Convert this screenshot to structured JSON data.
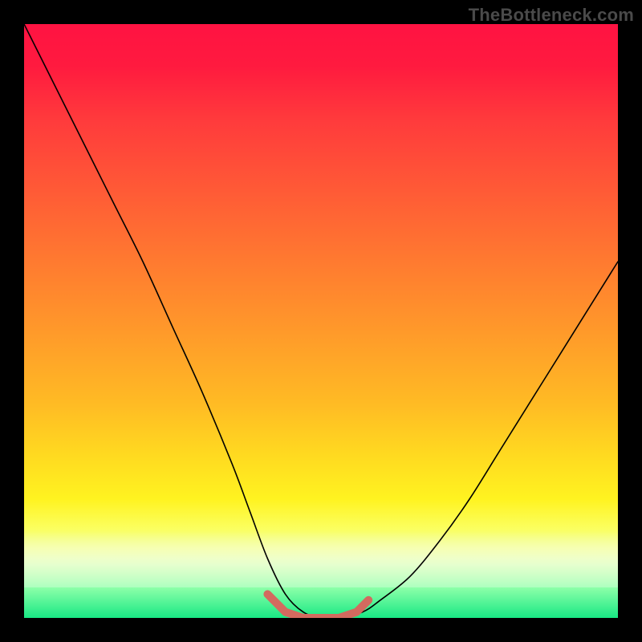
{
  "watermark": "TheBottleneck.com",
  "colors": {
    "background": "#000000",
    "curve": "#000000",
    "valley_highlight": "#d36a5f",
    "gradient_top": "#ff1342",
    "gradient_bottom": "#18e884"
  },
  "chart_data": {
    "type": "line",
    "title": "",
    "xlabel": "",
    "ylabel": "",
    "xlim": [
      0,
      100
    ],
    "ylim": [
      0,
      100
    ],
    "grid": false,
    "legend": false,
    "series": [
      {
        "name": "bottleneck-curve",
        "x": [
          0,
          5,
          10,
          15,
          20,
          25,
          30,
          35,
          38,
          41,
          44,
          47,
          50,
          53,
          57,
          60,
          65,
          70,
          75,
          80,
          85,
          90,
          95,
          100
        ],
        "y": [
          100,
          90,
          80,
          70,
          60,
          49,
          38,
          26,
          18,
          10,
          4,
          1,
          0,
          0,
          1,
          3,
          7,
          13,
          20,
          28,
          36,
          44,
          52,
          60
        ]
      }
    ],
    "highlight_valley": {
      "x": [
        41,
        44,
        47,
        50,
        53,
        56,
        58
      ],
      "y": [
        4,
        1,
        0,
        0,
        0,
        1,
        3
      ]
    },
    "background_gradient": {
      "direction": "vertical",
      "stops": [
        {
          "pos": 0.0,
          "color": "#ff1342"
        },
        {
          "pos": 0.28,
          "color": "#ff5a36"
        },
        {
          "pos": 0.55,
          "color": "#ff9a2a"
        },
        {
          "pos": 0.75,
          "color": "#ffdb20"
        },
        {
          "pos": 0.88,
          "color": "#fbff60"
        },
        {
          "pos": 1.0,
          "color": "#18e884"
        }
      ]
    }
  }
}
